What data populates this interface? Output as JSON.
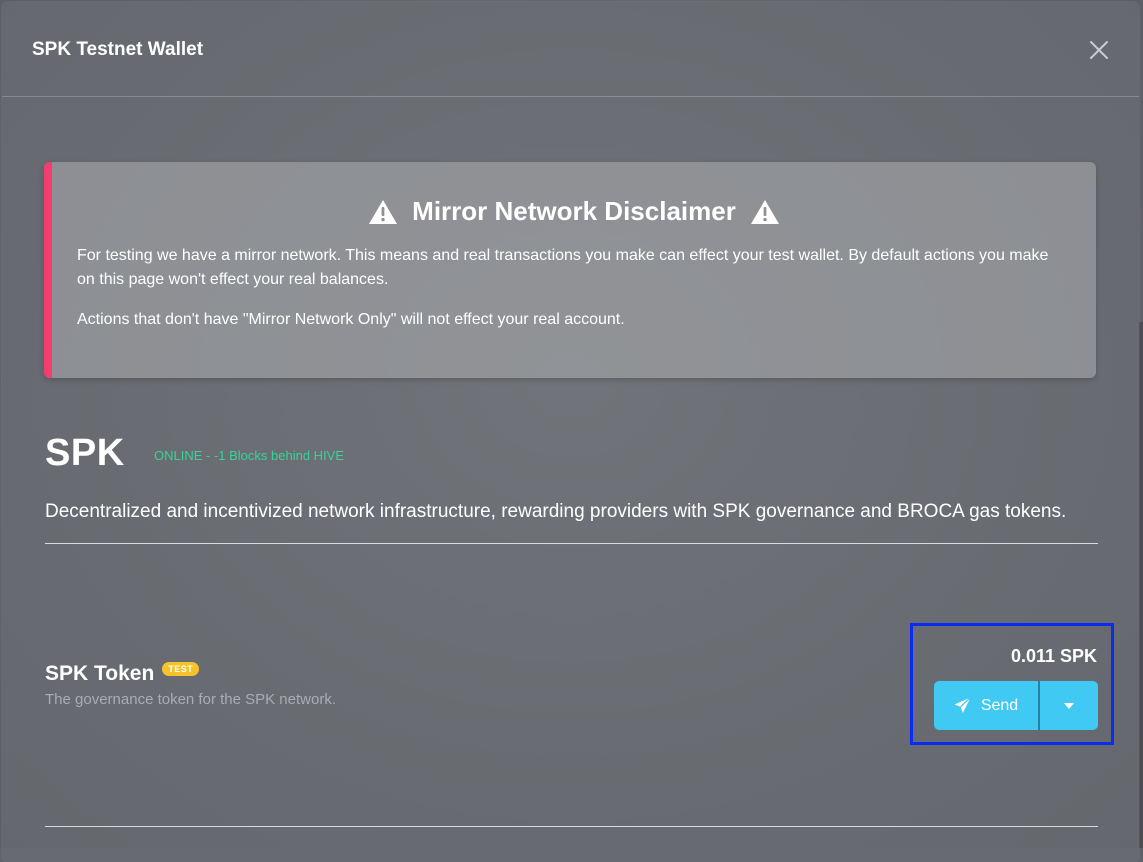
{
  "modal": {
    "title": "SPK Testnet Wallet"
  },
  "disclaimer": {
    "title": "Mirror Network Disclaimer",
    "paragraph1": "For testing we have a mirror network. This means and real transactions you make can effect your test wallet. By default actions you make on this page won't effect your real balances.",
    "paragraph2": "Actions that don't have \"Mirror Network Only\" will not effect your real account.",
    "accent_color": "#f23d6f"
  },
  "spk": {
    "title": "SPK",
    "status": "ONLINE - -1 Blocks behind HIVE",
    "status_color": "#36d39b",
    "description": "Decentralized and incentivized network infrastructure, rewarding providers with SPK governance and BROCA gas tokens."
  },
  "token": {
    "name": "SPK Token",
    "badge": "TEST",
    "description": "The governance token for the SPK network.",
    "balance": "0.011 SPK",
    "send_label": "Send",
    "button_color": "#3fc9f3",
    "highlight_color": "#0a2bf2"
  },
  "icons": {
    "close": "close-icon",
    "warning": "warning-icon",
    "send": "paper-plane-icon",
    "dropdown": "caret-down-icon"
  }
}
